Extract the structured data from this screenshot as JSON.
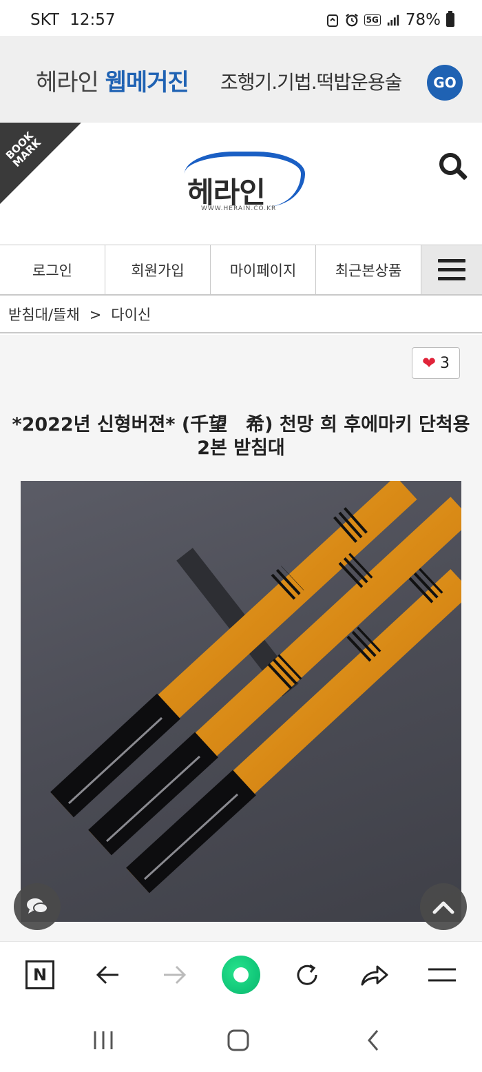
{
  "status_bar": {
    "carrier": "SKT",
    "time": "12:57",
    "network": "5G",
    "battery": "78%"
  },
  "banner": {
    "brand_plain": "헤라인",
    "brand_bold": "웹메거진",
    "tagline": "조행기.기법.떡밥운용술",
    "go_label": "GO"
  },
  "header": {
    "bookmark_label_1": "BOOK",
    "bookmark_label_2": "MARK",
    "logo_text": "헤라인",
    "logo_url": "WWW.HERAIN.CO.KR"
  },
  "nav": {
    "items": [
      "로그인",
      "회원가입",
      "마이페이지",
      "최근본상품"
    ]
  },
  "breadcrumb": {
    "category": "받침대/뜰채",
    "separator": ">",
    "current": "다이신"
  },
  "product": {
    "like_count": "3",
    "title": "*2022년 신형버젼* (千望　希) 천망 희 후에마키 단척용 2본 받침대"
  },
  "colors": {
    "brand_blue": "#1f62b3",
    "heart_red": "#e0243a",
    "rod_orange": "#e49a1e",
    "browser_home_green": "#12c87a"
  },
  "icons": {
    "search": "search-icon",
    "menu": "hamburger-icon",
    "heart": "heart-icon",
    "chat": "chat-icon",
    "scroll_top": "chevron-up-icon"
  }
}
